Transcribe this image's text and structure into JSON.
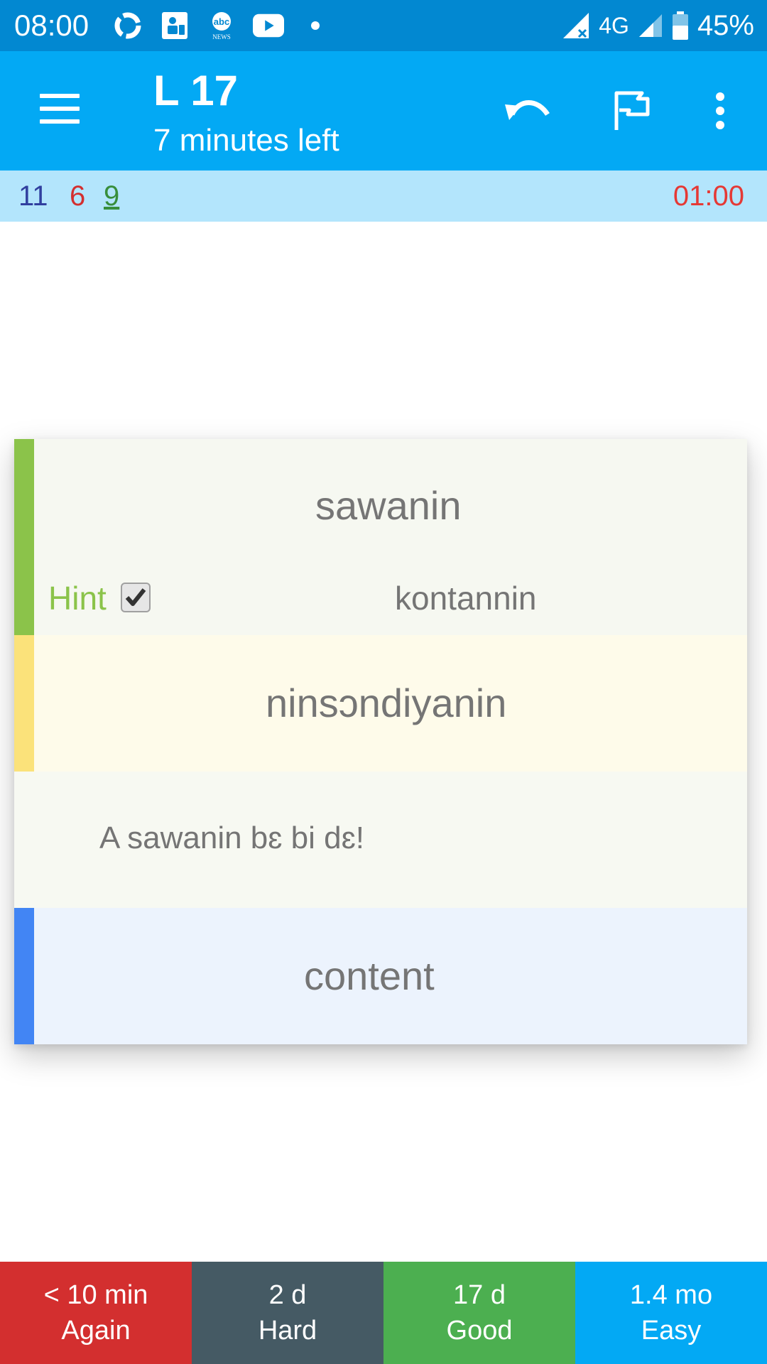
{
  "status_bar": {
    "time": "08:00",
    "network": "4G",
    "battery": "45%",
    "left_icons": [
      "sync-icon",
      "contact-card-icon",
      "abc-news-icon",
      "youtube-icon",
      "dot-icon"
    ]
  },
  "toolbar": {
    "title": "L 17",
    "subtitle": "7 minutes left",
    "icons": [
      "menu-icon",
      "undo-icon",
      "flag-icon",
      "more-vert-icon"
    ]
  },
  "counts": {
    "new": "11",
    "learning": "6",
    "review": "9",
    "timer": "01:00",
    "colors": {
      "new": "#303f9f",
      "learning": "#d32f2f",
      "review": "#388e3c",
      "timer": "#e53935"
    }
  },
  "card": {
    "front_word": "sawanin",
    "hint_label": "Hint",
    "hint_checked": true,
    "hint_word": "kontannin",
    "plural": "ninsɔndiyanin",
    "example_sentence": "A sawanin bɛ bi dɛ!",
    "translation": "content",
    "stripe_colors": [
      "#8bc34a",
      "#fbe27a",
      "#4285f4"
    ]
  },
  "answers": [
    {
      "interval": "< 10 min",
      "label": "Again",
      "color": "#d32f2f"
    },
    {
      "interval": "2 d",
      "label": "Hard",
      "color": "#455a64"
    },
    {
      "interval": "17 d",
      "label": "Good",
      "color": "#4caf50"
    },
    {
      "interval": "1.4 mo",
      "label": "Easy",
      "color": "#03a9f4"
    }
  ]
}
